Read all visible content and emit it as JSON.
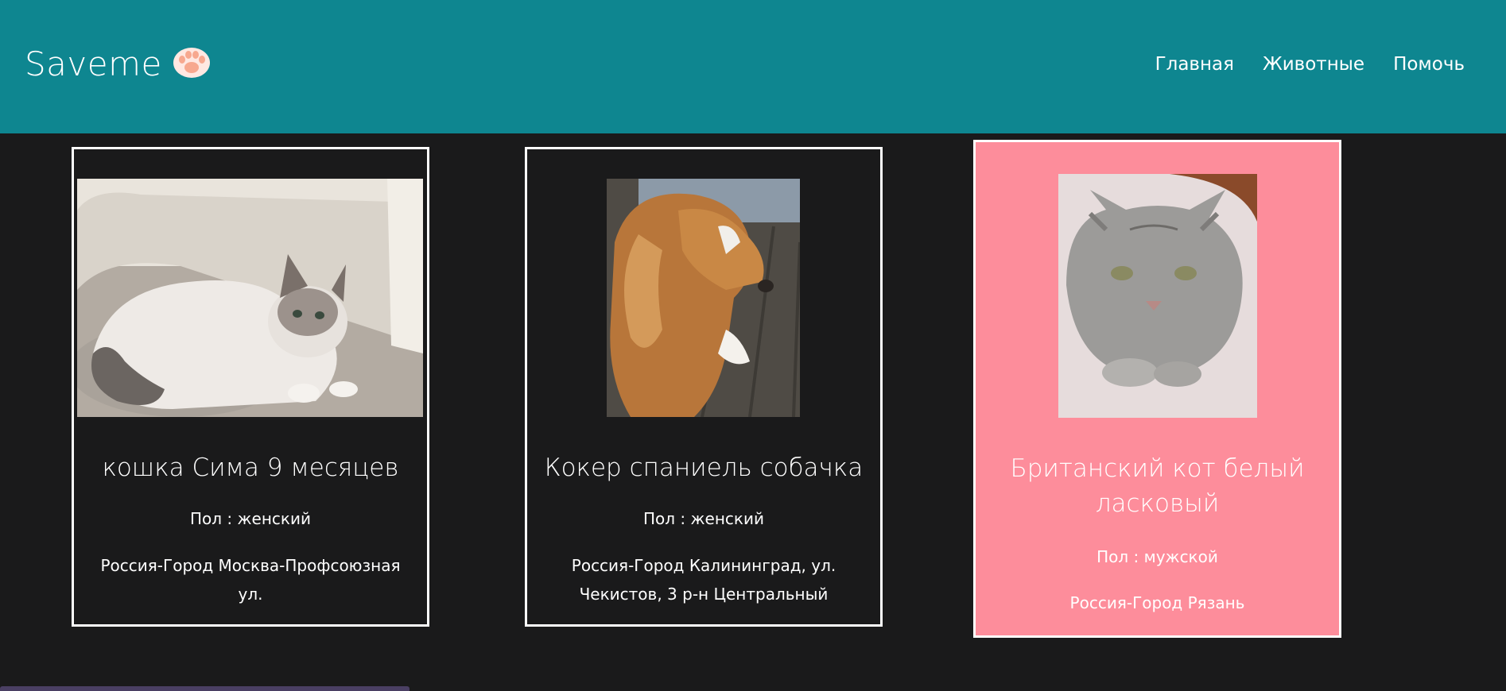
{
  "header": {
    "brand": "Saveme",
    "brand_icon": "paw-icon",
    "nav": [
      "Главная",
      "Животные",
      "Помочь"
    ]
  },
  "cards": [
    {
      "title": "кошка Сима 9 месяцев",
      "sex": "Пол : женский",
      "address": "Россия-Город Москва-Профсоюзная ул.",
      "photo": "white-cat-photo"
    },
    {
      "title": "Кокер спаниель собачка",
      "sex": "Пол : женский",
      "address": "Россия-Город Калининград, ул. Чекистов, 3 р-н Центральный",
      "photo": "spaniel-dog-photo"
    },
    {
      "title": "Британский кот белый ласковый",
      "sex": "Пол : мужской",
      "address": "Россия-Город Рязань",
      "photo": "british-cat-photo",
      "highlight_color": "#fd8d9b"
    }
  ],
  "colors": {
    "header": "#0e8690",
    "background": "#1a1a1b",
    "card_highlight": "#fd8d9b"
  }
}
